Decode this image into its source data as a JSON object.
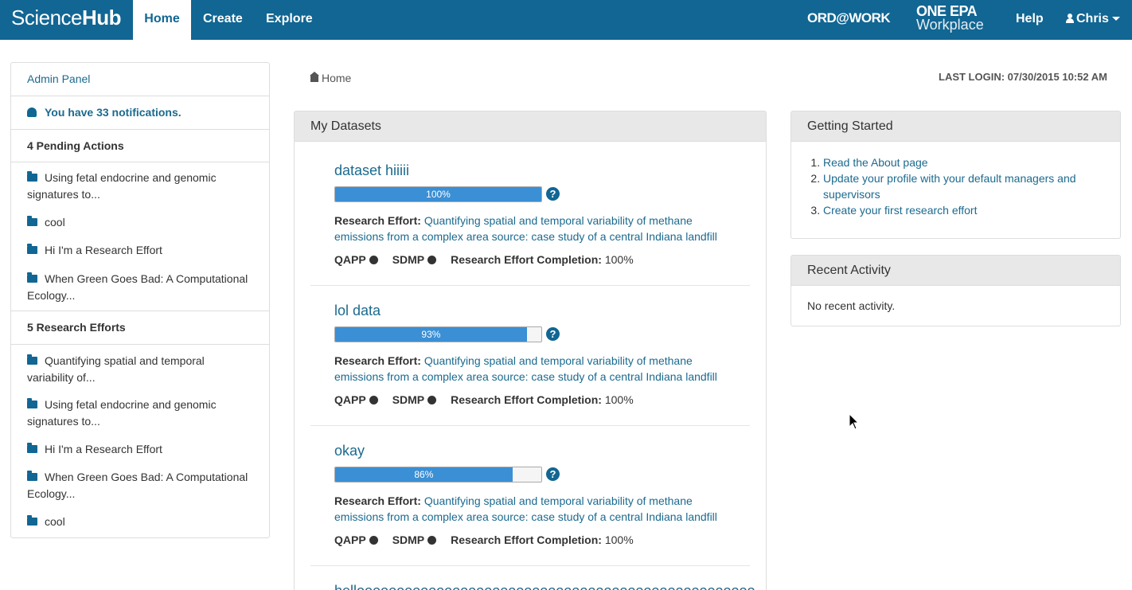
{
  "navbar": {
    "brand_light": "Science",
    "brand_bold": "Hub",
    "items": [
      {
        "label": "Home",
        "active": true
      },
      {
        "label": "Create",
        "active": false
      },
      {
        "label": "Explore",
        "active": false
      }
    ],
    "ordwork": "ORD@WORK",
    "oneepa_line1": "ONE EPA",
    "oneepa_line2": "Workplace",
    "help": "Help",
    "user": "Chris"
  },
  "sidebar": {
    "admin_panel": "Admin Panel",
    "notifications": "You have 33 notifications.",
    "pending_heading": "4 Pending Actions",
    "pending_items": [
      "Using fetal endocrine and genomic signatures to...",
      "cool",
      "Hi I'm a Research Effort",
      "When Green Goes Bad: A Computational Ecology..."
    ],
    "efforts_heading": "5 Research Efforts",
    "effort_items": [
      "Quantifying spatial and temporal variability of...",
      "Using fetal endocrine and genomic signatures to...",
      "Hi I'm a Research Effort",
      "When Green Goes Bad: A Computational Ecology...",
      "cool"
    ]
  },
  "breadcrumb": "Home",
  "last_login": "LAST LOGIN: 07/30/2015 10:52 AM",
  "my_datasets": {
    "heading": "My Datasets",
    "research_effort_label": "Research Effort:",
    "qapp_label": "QAPP",
    "sdmp_label": "SDMP",
    "completion_label": "Research Effort Completion:",
    "datasets": [
      {
        "title": "dataset hiiiii",
        "progress": 100,
        "progress_text": "100%",
        "research_effort": "Quantifying spatial and temporal variability of methane emissions from a complex area source: case study of a central Indiana landfill",
        "completion": "100%"
      },
      {
        "title": "lol data",
        "progress": 93,
        "progress_text": "93%",
        "research_effort": "Quantifying spatial and temporal variability of methane emissions from a complex area source: case study of a central Indiana landfill",
        "completion": "100%"
      },
      {
        "title": "okay",
        "progress": 86,
        "progress_text": "86%",
        "research_effort": "Quantifying spatial and temporal variability of methane emissions from a complex area source: case study of a central Indiana landfill",
        "completion": "100%"
      },
      {
        "title": "helloooooooooooooooooooooooooooooooooooooooooooooooooo"
      }
    ]
  },
  "getting_started": {
    "heading": "Getting Started",
    "items": [
      "Read the About page",
      "Update your profile with your default managers and supervisors",
      "Create your first research effort"
    ]
  },
  "recent_activity": {
    "heading": "Recent Activity",
    "empty_text": "No recent activity."
  },
  "colors": {
    "navbar": "#116693",
    "link": "#1b6a8f",
    "progress": "#3b8fd4"
  }
}
